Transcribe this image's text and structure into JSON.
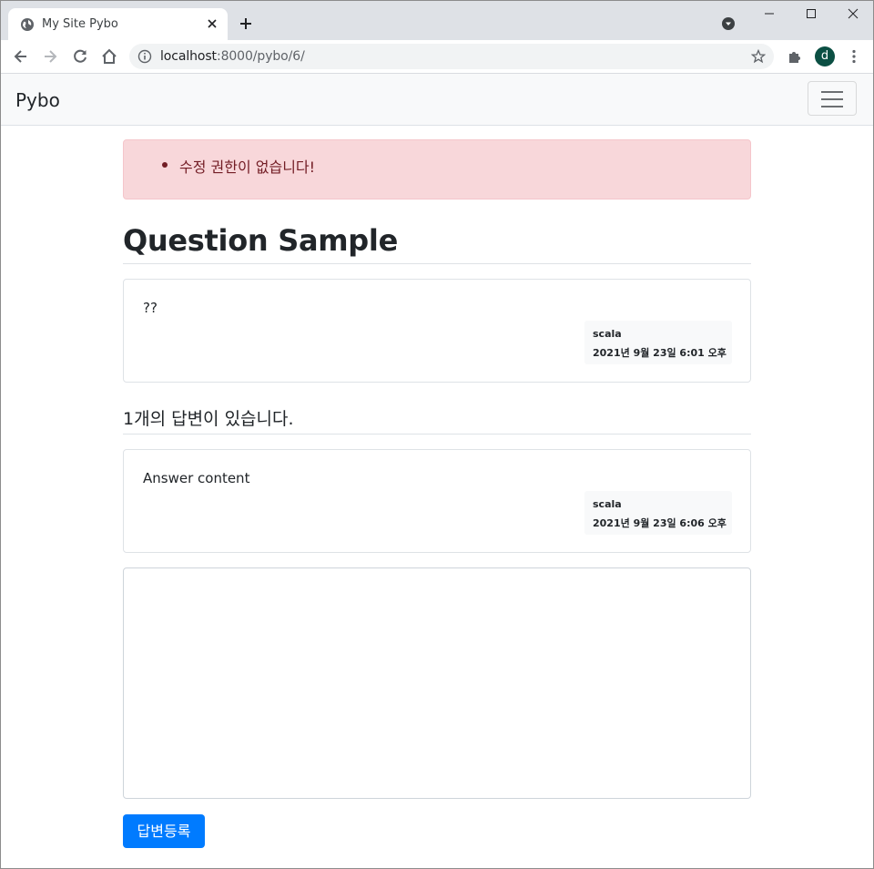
{
  "browser": {
    "tab_title": "My Site Pybo",
    "url_host": "localhost",
    "url_rest": ":8000/pybo/6/",
    "profile_initial": "d"
  },
  "navbar": {
    "brand": "Pybo"
  },
  "alert": {
    "message": "수정 권한이 없습니다!"
  },
  "question": {
    "title": "Question Sample",
    "content": "??",
    "author": "scala",
    "date": "2021년 9월 23일 6:01 오후"
  },
  "answers": {
    "count_label": "1개의 답변이 있습니다.",
    "items": [
      {
        "content": "Answer content",
        "author": "scala",
        "date": "2021년 9월 23일 6:06 오후"
      }
    ]
  },
  "answer_form": {
    "content": "",
    "submit_label": "답변등록"
  },
  "colors": {
    "primary": "#007bff",
    "alert_bg": "#f8d7da",
    "alert_text": "#721c24"
  }
}
